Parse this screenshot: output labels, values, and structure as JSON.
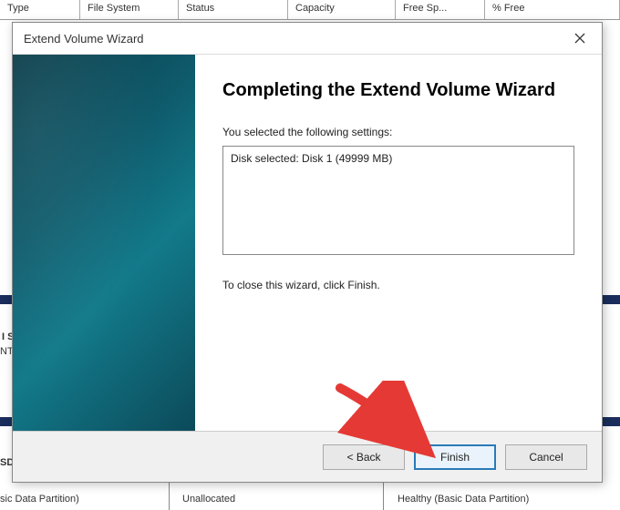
{
  "background": {
    "headers": [
      "Type",
      "File System",
      "Status",
      "Capacity",
      "Free Sp...",
      "% Free"
    ],
    "row_left_1": "SD",
    "row_left_2": "sic Data Partition)",
    "row_mid": "Unallocated",
    "row_right": "Healthy (Basic Data Partition)",
    "side_label_1": "I S",
    "side_label_2": "NT"
  },
  "dialog": {
    "title": "Extend Volume Wizard",
    "heading": "Completing the Extend Volume Wizard",
    "subtext": "You selected the following settings:",
    "settings_content": "Disk selected: Disk 1 (49999 MB)",
    "close_hint": "To close this wizard, click Finish.",
    "buttons": {
      "back": "< Back",
      "finish": "Finish",
      "cancel": "Cancel"
    }
  }
}
